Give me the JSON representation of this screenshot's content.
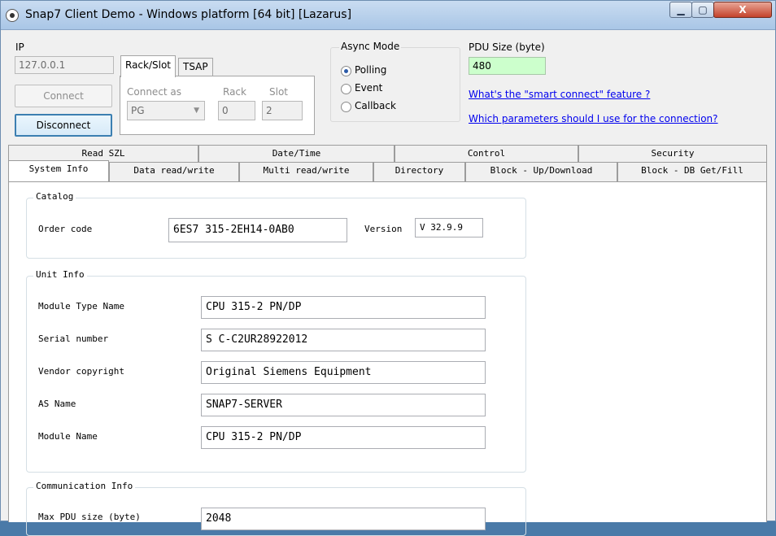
{
  "window": {
    "title": "Snap7 Client Demo - Windows platform [64 bit] [Lazarus]",
    "min_glyph": "▁",
    "max_glyph": "▢",
    "close_glyph": "X"
  },
  "connection": {
    "ip_label": "IP",
    "ip_value": "127.0.0.1",
    "connect_label": "Connect",
    "disconnect_label": "Disconnect",
    "tabs": [
      "Rack/Slot",
      "TSAP"
    ],
    "connect_as_label": "Connect as",
    "connect_as_value": "PG",
    "rack_label": "Rack",
    "rack_value": "0",
    "slot_label": "Slot",
    "slot_value": "2"
  },
  "async": {
    "title": "Async Mode",
    "options": [
      "Polling",
      "Event",
      "Callback"
    ],
    "selected": "Polling"
  },
  "pdu": {
    "label": "PDU Size (byte)",
    "value": "480",
    "value_bg": "#ccffcc",
    "link_smart": "What's the \"smart connect\" feature ?",
    "link_params": "Which parameters should I use for the connection?"
  },
  "tabs": {
    "top_row": [
      "Read SZL",
      "Date/Time",
      "Control",
      "Security"
    ],
    "bottom_row": [
      "System Info",
      "Data read/write",
      "Multi read/write",
      "Directory",
      "Block - Up/Download",
      "Block - DB Get/Fill"
    ],
    "selected": "System Info"
  },
  "catalog": {
    "title": "Catalog",
    "order_code_label": "Order code",
    "order_code_value": "6ES7 315-2EH14-0AB0",
    "version_label": "Version",
    "version_value": "V 32.9.9"
  },
  "unit_info": {
    "title": "Unit Info",
    "rows": [
      {
        "label": "Module Type Name",
        "value": "CPU 315-2 PN/DP"
      },
      {
        "label": "Serial number",
        "value": "S C-C2UR28922012"
      },
      {
        "label": "Vendor copyright",
        "value": "Original Siemens Equipment"
      },
      {
        "label": "AS Name",
        "value": "SNAP7-SERVER"
      },
      {
        "label": "Module Name",
        "value": "CPU 315-2 PN/DP"
      }
    ]
  },
  "comm_info": {
    "title": "Communication Info",
    "rows": [
      {
        "label": "Max PDU size (byte)",
        "value": "2048"
      }
    ]
  },
  "colors": {
    "window_bg": "#f0f0f0",
    "link": "#0000ee",
    "active_button_border": "#3c7fb1"
  }
}
